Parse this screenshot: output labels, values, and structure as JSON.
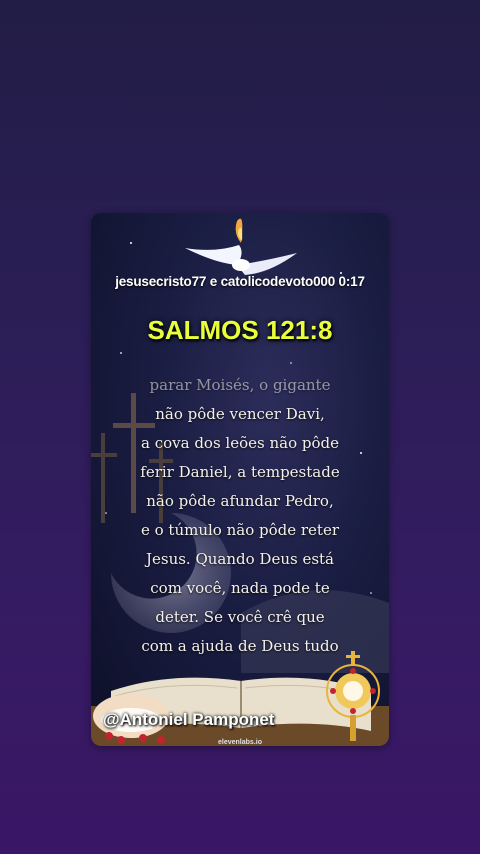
{
  "overlay": {
    "header": "jesusecristo77 e catolicodevoto000  0:17",
    "handle": "@Antoniel Pamponet",
    "watermark": "elevenlabs.io"
  },
  "content": {
    "title": "SALMOS 121:8",
    "verse_lines": [
      "parar Moisés, o gigante",
      "não pôde vencer Davi,",
      "a cova dos leões não pôde",
      "ferir Daniel, a tempestade",
      "não pôde afundar Pedro,",
      "e o túmulo não pôde reter",
      "Jesus. Quando Deus está",
      "com você, nada pode te",
      "deter. Se você crê que",
      "com a ajuda de Deus tudo"
    ]
  },
  "colors": {
    "title": "#e8ff3a",
    "background": "#2a1e55"
  }
}
